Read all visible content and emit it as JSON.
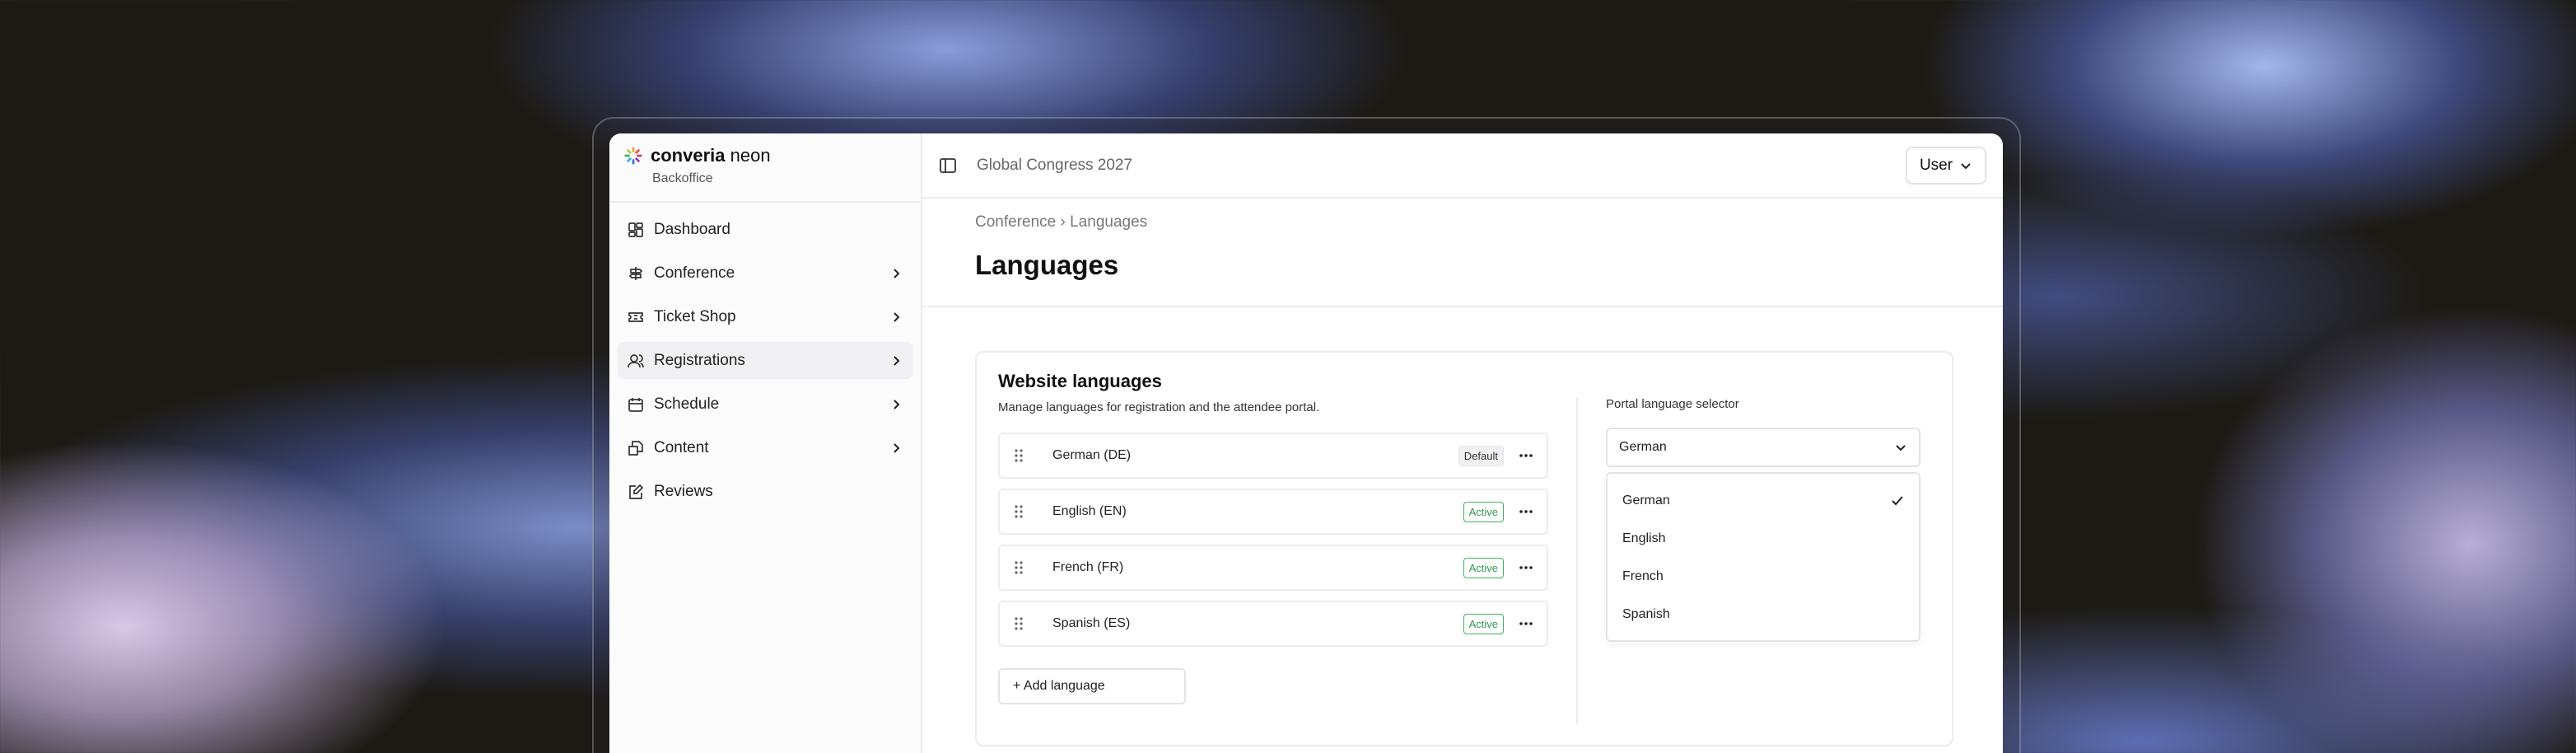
{
  "brand": {
    "name_bold": "converia",
    "name_light": " neon",
    "subtitle": "Backoffice"
  },
  "sidebar": {
    "items": [
      {
        "label": "Dashboard",
        "icon": "dashboard-icon",
        "has_chevron": false
      },
      {
        "label": "Conference",
        "icon": "signpost-icon",
        "has_chevron": true
      },
      {
        "label": "Ticket Shop",
        "icon": "ticket-icon",
        "has_chevron": true
      },
      {
        "label": "Registrations",
        "icon": "users-icon",
        "has_chevron": true,
        "active": true
      },
      {
        "label": "Schedule",
        "icon": "calendar-icon",
        "has_chevron": true
      },
      {
        "label": "Content",
        "icon": "content-icon",
        "has_chevron": true
      },
      {
        "label": "Reviews",
        "icon": "review-icon",
        "has_chevron": false
      }
    ]
  },
  "topbar": {
    "event_title": "Global Congress 2027",
    "user_label": "User"
  },
  "header": {
    "breadcrumb": "Conference › Languages",
    "title": "Languages"
  },
  "website_languages": {
    "title": "Website languages",
    "description": "Manage languages for registration and the attendee portal.",
    "languages": [
      {
        "name": "German (DE)",
        "status": "Default"
      },
      {
        "name": "English (EN)",
        "status": "Active"
      },
      {
        "name": "French (FR)",
        "status": "Active"
      },
      {
        "name": "Spanish (ES)",
        "status": "Active"
      }
    ],
    "add_label": "+ Add language"
  },
  "portal_selector": {
    "label": "Portal language selector",
    "selected": "German",
    "options": [
      "German",
      "English",
      "French",
      "Spanish"
    ]
  },
  "colors": {
    "active_badge": "#3fb25f",
    "border": "#ececef"
  }
}
